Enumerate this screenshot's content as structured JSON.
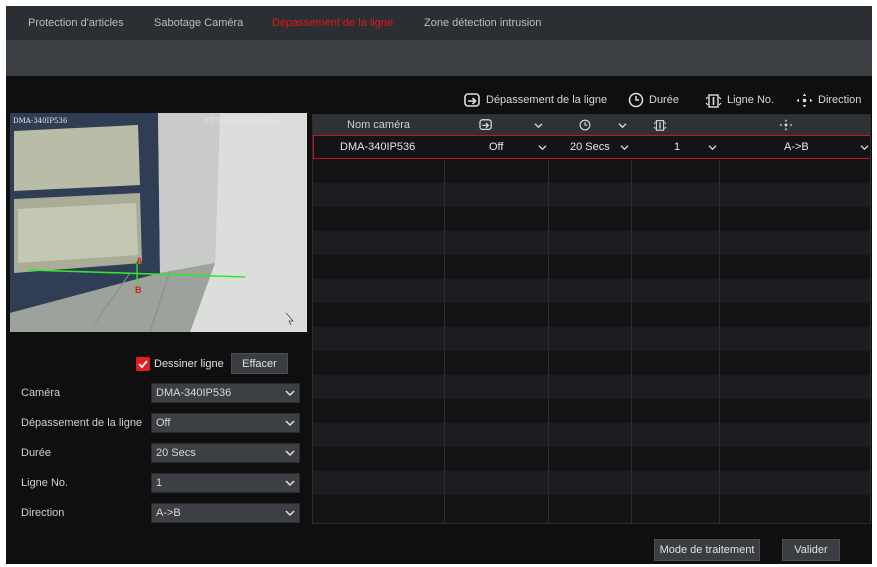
{
  "tabs": [
    {
      "label": "Protection d'articles",
      "active": false
    },
    {
      "label": "Sabotage Caméra",
      "active": false
    },
    {
      "label": "Dépassement de la ligne",
      "active": true
    },
    {
      "label": "Zone détection intrusion",
      "active": false
    }
  ],
  "legend": {
    "crossing": "Dépassement de la ligne",
    "duration": "Durée",
    "line_no": "Ligne No.",
    "direction": "Direction"
  },
  "preview": {
    "camera_overlay": "DMA-340IP536",
    "timestamp_overlay": "07/30/2018 11:09:10",
    "point_a": "A",
    "point_b": "B"
  },
  "draw": {
    "checkbox_label": "Dessiner ligne",
    "checked": true,
    "clear_label": "Effacer"
  },
  "form": {
    "camera": {
      "label": "Caméra",
      "value": "DMA-340IP536"
    },
    "crossing": {
      "label": "Dépassement de la ligne",
      "value": "Off"
    },
    "duration": {
      "label": "Durée",
      "value": "20 Secs"
    },
    "line_no": {
      "label": "Ligne No.",
      "value": "1"
    },
    "direction": {
      "label": "Direction",
      "value": "A->B"
    }
  },
  "table": {
    "header": {
      "camera_name": "Nom caméra"
    },
    "rows": [
      {
        "camera": "DMA-340IP536",
        "crossing": "Off",
        "duration": "20 Secs",
        "line_no": "1",
        "direction": "A->B"
      }
    ]
  },
  "footer": {
    "processing_mode": "Mode de traitement",
    "validate": "Valider"
  },
  "colors": {
    "accent": "#e01818",
    "background": "#0f0f10",
    "tabbar": "#2b2e32",
    "line": "#2ee82e"
  },
  "icons": [
    "crossing-icon",
    "clock-icon",
    "line-number-icon",
    "direction-icon",
    "chevron-down-icon",
    "checkmark-icon"
  ]
}
